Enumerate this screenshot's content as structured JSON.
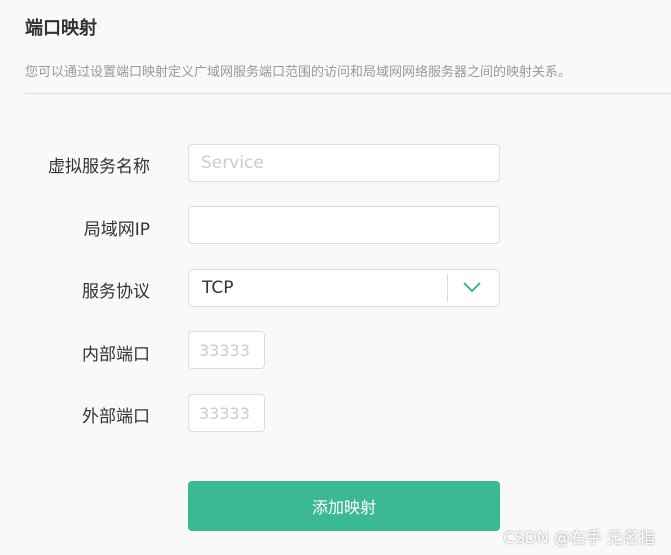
{
  "header": {
    "title": "端口映射",
    "description": "您可以通过设置端口映射定义广域网服务端口范围的访问和局域网网络服务器之间的映射关系。"
  },
  "form": {
    "service_name": {
      "label": "虚拟服务名称",
      "value": "",
      "placeholder": "Service"
    },
    "lan_ip": {
      "label": "局域网IP",
      "value": "",
      "placeholder": ""
    },
    "protocol": {
      "label": "服务协议",
      "value": "TCP",
      "icon": "chevron-down-icon"
    },
    "internal_port": {
      "label": "内部端口",
      "value": "",
      "placeholder": "33333"
    },
    "external_port": {
      "label": "外部端口",
      "value": "",
      "placeholder": "33333"
    },
    "submit_label": "添加映射"
  },
  "colors": {
    "accent": "#3bb993"
  },
  "watermark": "CSDN @右手 无名指"
}
